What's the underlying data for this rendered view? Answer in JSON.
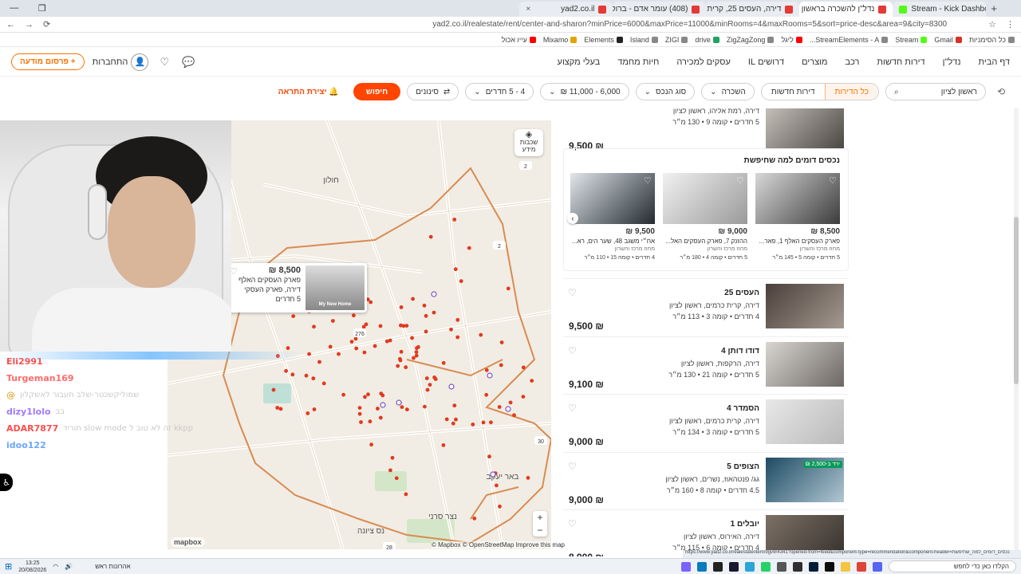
{
  "browser": {
    "tabs": [
      {
        "title": "yad2.co.il",
        "active": false
      },
      {
        "title": "(408) עומר אדם - ברוק כמעי",
        "active": false
      },
      {
        "title": "דירה, העסים 25, קרית כרמים, ר",
        "active": false
      },
      {
        "title": "נדל\"ן להשכרה בראשון לציון | יד",
        "active": true
      },
      {
        "title": "Stream - Kick Dashboard",
        "active": false
      }
    ],
    "url": "yad2.co.il/realestate/rent/center-and-sharon?minPrice=6000&maxPrice=11000&minRooms=4&maxRooms=5&sort=price-desc&area=9&city=8300",
    "bookmarks": [
      "כל הסימניות",
      "Gmail",
      "Stream",
      "StreamElements - A...",
      "ליגל",
      "ZigZagZong",
      "drive",
      "ZIGI",
      "Island",
      "Elements",
      "Mixamo",
      "עייו אכול"
    ]
  },
  "header": {
    "nav": [
      "דף הבית",
      "נדל\"ן",
      "דירות חדשות",
      "רכב",
      "מוצרים",
      "דרושים IL",
      "עסקים למכירה",
      "חיות מחמד",
      "בעלי מקצוע"
    ],
    "post_ad": "+ פרסום מודעה",
    "login": "התחברות"
  },
  "filters": {
    "city": "ראשון לציון",
    "seg_all": "כל הדירות",
    "seg_new": "דירות חדשות",
    "deal": "השכרה",
    "property_type": "סוג הנכס",
    "price_range": "6,000 - 11,000 ₪",
    "rooms": "4 - 5 חדרים",
    "more_filters": "סינונים",
    "search": "חיפוש",
    "alert": "יצירת התראה"
  },
  "map": {
    "layers_label": "שכבות מידע",
    "attribution": "© Mapbox © OpenStreetMap  Improve this map",
    "logo": "mapbox",
    "popup": {
      "price": "8,500 ₪",
      "title": "פארק העסקים האלף",
      "type": "דירה, פארק העסקי",
      "meta": "5 חדרים",
      "image_caption": "My New Home"
    },
    "cluster_labels": [
      "2",
      "2",
      "276",
      "30",
      "28"
    ],
    "place_labels": [
      "חולון",
      "בת ים",
      "באר יעקב",
      "נס ציונה",
      "נצר סרני"
    ]
  },
  "chat": [
    {
      "user": "Eli2991",
      "color": "#ff4d4d",
      "msg": ""
    },
    {
      "user": "Turgeman169",
      "color": "#ff6b6b",
      "msg": ""
    },
    {
      "user": "@",
      "color": "#e0b040",
      "msg": "שמוליקשכטר-שלב תעבור לאשקלון"
    },
    {
      "user": "dizy1lolo",
      "color": "#9f7bff",
      "msg": "בב"
    },
    {
      "user": "ADAR7877",
      "color": "#ff4d4d",
      "msg": "תוריד slow mode זה לא טוב ל kkpp"
    },
    {
      "user": "idoo122",
      "color": "#6aa6ff",
      "msg": ""
    }
  ],
  "listings_top": {
    "price": "9,500 ₪",
    "sub": "דירה, רמת אליהו, ראשון לציון",
    "meta": "5 חדרים • קומה 9 • 130 מ״ר"
  },
  "similar": {
    "heading": "נכסים דומים למה שחיפשת",
    "cards": [
      {
        "price": "8,500 ₪",
        "addr": "פארק העסקים האלף 1, פאר...",
        "sub": "מחוז מרכז והשרון",
        "meta": "5 חדרים • קומה 5 • 145 מ״ר"
      },
      {
        "price": "9,000 ₪",
        "addr": "ההזנק 7, פארק העסקים האל...",
        "sub": "מחוז מרכז והשרון",
        "meta": "5 חדרים • קומה 4 • 180 מ״ר"
      },
      {
        "price": "9,500 ₪",
        "addr": "אח״י משגב 48, שער הים, רא...",
        "sub": "מחוז מרכז והשרון",
        "meta": "4 חדרים • קומה 15 • 110 מ״ר"
      }
    ]
  },
  "listings": [
    {
      "title": "העסים 25",
      "sub": "דירה, קרית כרמים, ראשון לציון",
      "meta": "4 חדרים • קומה 3 • 113 מ״ר",
      "price": "9,500 ₪",
      "badge": ""
    },
    {
      "title": "דודו דותן 4",
      "sub": "דירה, הרקפות, ראשון לציון",
      "meta": "5 חדרים • קומה 21 • 130 מ״ר",
      "price": "9,100 ₪",
      "badge": ""
    },
    {
      "title": "הסמדר 4",
      "sub": "דירה, קרית כרמים, ראשון לציון",
      "meta": "5 חדרים • קומה 3 • 134 מ״ר",
      "price": "9,000 ₪",
      "badge": ""
    },
    {
      "title": "הצופים 5",
      "sub": "גג/ פנטהאוז, נשרים, ראשון לציון",
      "meta": "4.5 חדרים • קומה 8 • 160 מ״ר",
      "price": "9,000 ₪",
      "badge": "ירד ב-2,500 ₪"
    },
    {
      "title": "יובלים 1",
      "sub": "דירה, האירוס, ראשון לציון",
      "meta": "4 חדרים • קומה 6 • 115 מ״ר",
      "price": "8,900 ₪",
      "badge": ""
    }
  ],
  "status_url": "https://www.yad2.co.il/realestate/item/9gv9r4341?opened-from=feed&component-type=recommendation&component-header=נכסים_דומים_למה_שחיפשת",
  "taskbar": {
    "time": "13:25",
    "date": "20/08/2026",
    "search_placeholder": "הקלדו כאן כדי לחפש",
    "news": "אהרונות ראש"
  },
  "colors": {
    "brand_orange": "#ff7100",
    "search_red": "#ff4500",
    "map_dot": "#e03a1e",
    "boundary": "#d98b52"
  }
}
